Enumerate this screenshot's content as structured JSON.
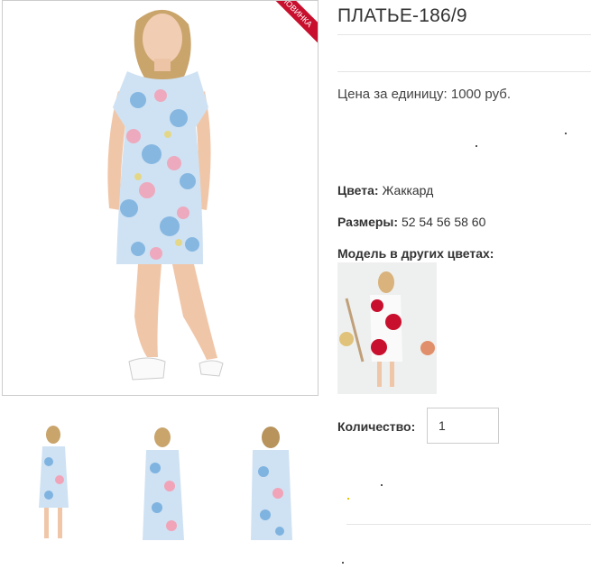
{
  "product": {
    "ribbon": "НОВИНКА",
    "title": "ПЛАТЬЕ-186/9",
    "price": "Цена за единицу: 1000 руб.",
    "colors_label": "Цвета:",
    "colors_value": "Жаккард",
    "sizes_label": "Размеры:",
    "sizes_value": "52 54 56 58 60",
    "other_colors_label": "Модель в других цветах:",
    "quantity_label": "Количество:",
    "quantity_value": "1"
  },
  "palette": {
    "ribbon": "#c8102e",
    "dress_blue": "#7fb3e0",
    "dress_pink": "#f1a3b8",
    "dress_red": "#c8102e"
  }
}
